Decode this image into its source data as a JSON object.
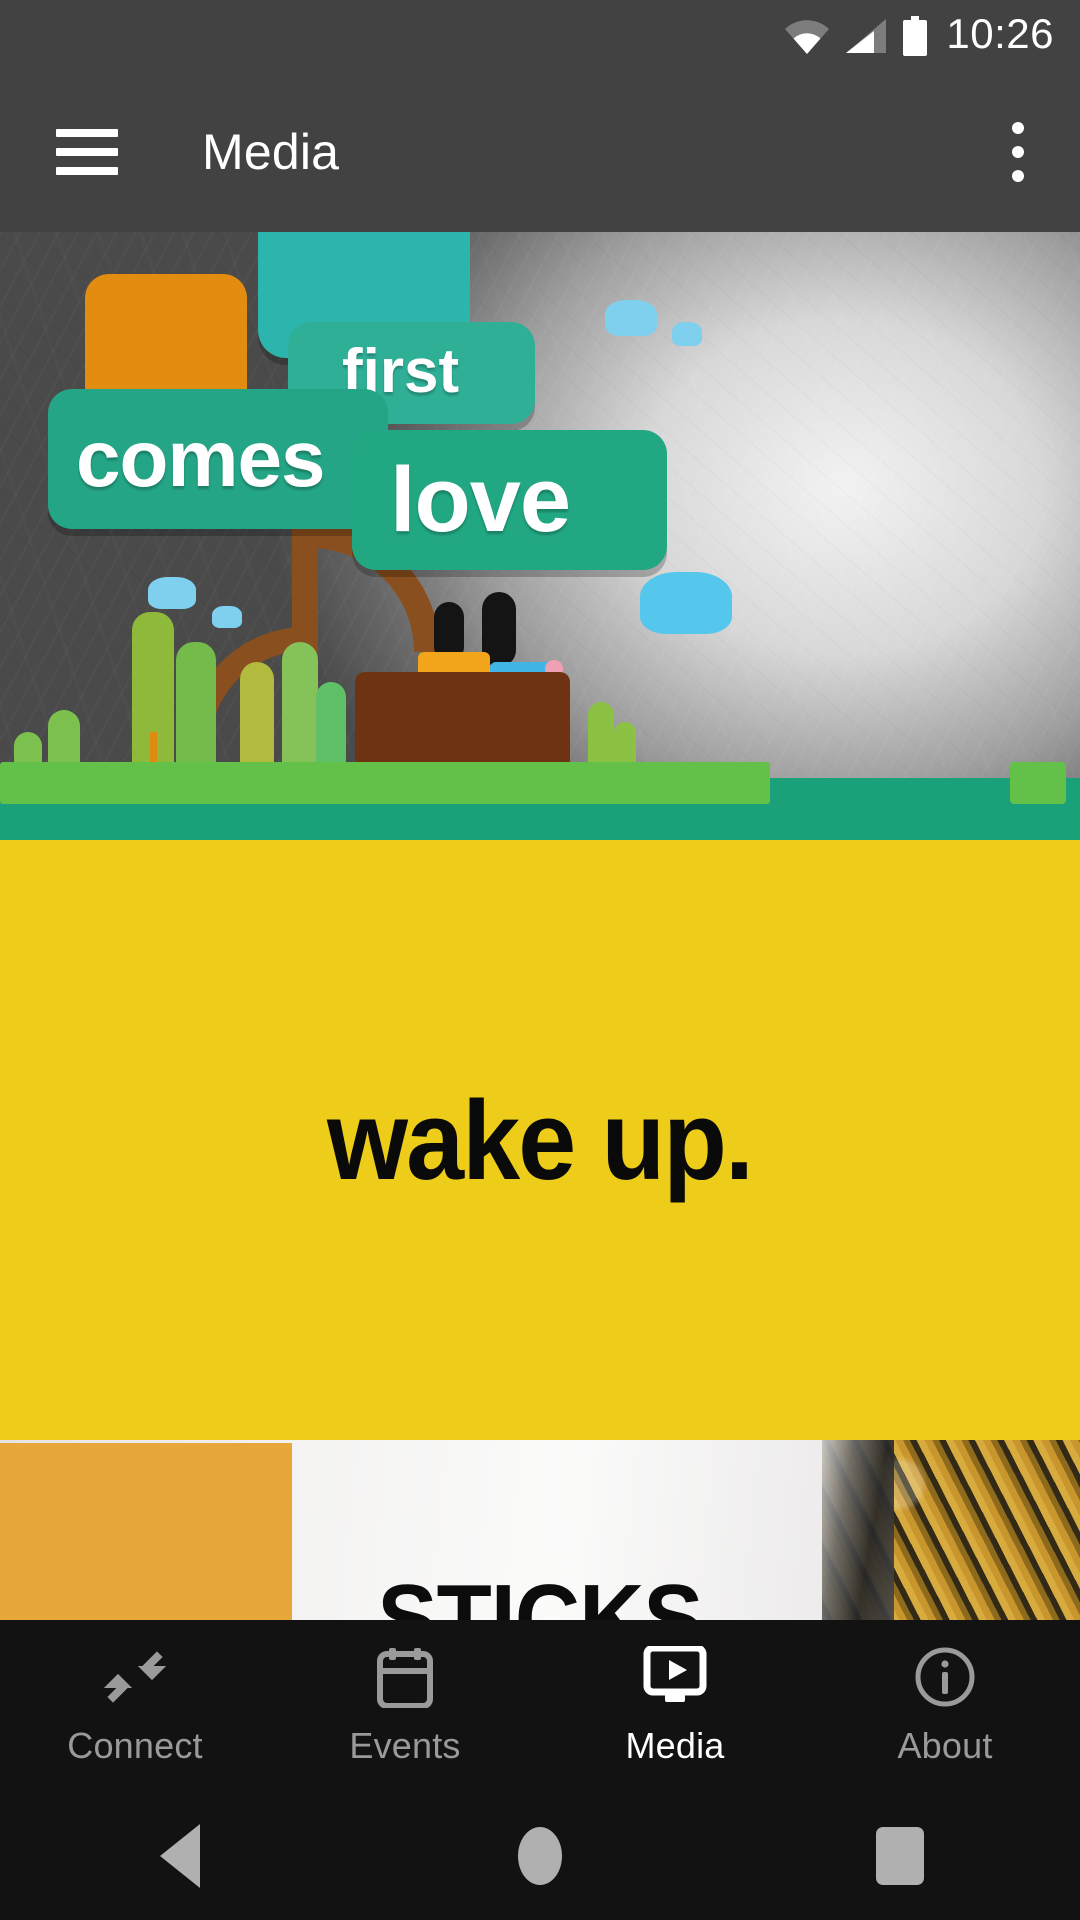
{
  "status_bar": {
    "time": "10:26",
    "wifi_icon": "wifi-icon",
    "signal_icon": "cellular-signal-icon",
    "battery_icon": "battery-full-icon"
  },
  "app_bar": {
    "menu_icon": "hamburger-menu-icon",
    "title": "Media",
    "overflow_icon": "overflow-menu-icon"
  },
  "feed": {
    "cards": [
      {
        "id": "first-comes-love",
        "type": "image",
        "sign_words": [
          "first",
          "comes",
          "love"
        ],
        "alt": "Paper craft illustration of a couple on a bench under a tree with signs reading first comes love"
      },
      {
        "id": "wake-up",
        "type": "title",
        "title": "wake up.",
        "background": "#edcd1a",
        "text_color": "#0a0a0a"
      },
      {
        "id": "sticks",
        "type": "image",
        "title": "STICKS",
        "alt": "Poster with orange block, white wall and gold textured rock"
      }
    ]
  },
  "bottom_nav": {
    "items": [
      {
        "label": "Connect",
        "icon": "connect-arrows-icon",
        "active": false
      },
      {
        "label": "Events",
        "icon": "calendar-icon",
        "active": false
      },
      {
        "label": "Media",
        "icon": "media-play-screen-icon",
        "active": true
      },
      {
        "label": "About",
        "icon": "info-circle-icon",
        "active": false
      }
    ]
  },
  "android_nav": {
    "back": "back-button",
    "home": "home-button",
    "recents": "recents-button"
  },
  "colors": {
    "app_bar": "#424242",
    "status_bar": "#424242",
    "nav_bar": "#121212",
    "accent_yellow": "#edcd1a",
    "active_label": "#ffffff",
    "inactive_label": "#9a9a9a"
  }
}
